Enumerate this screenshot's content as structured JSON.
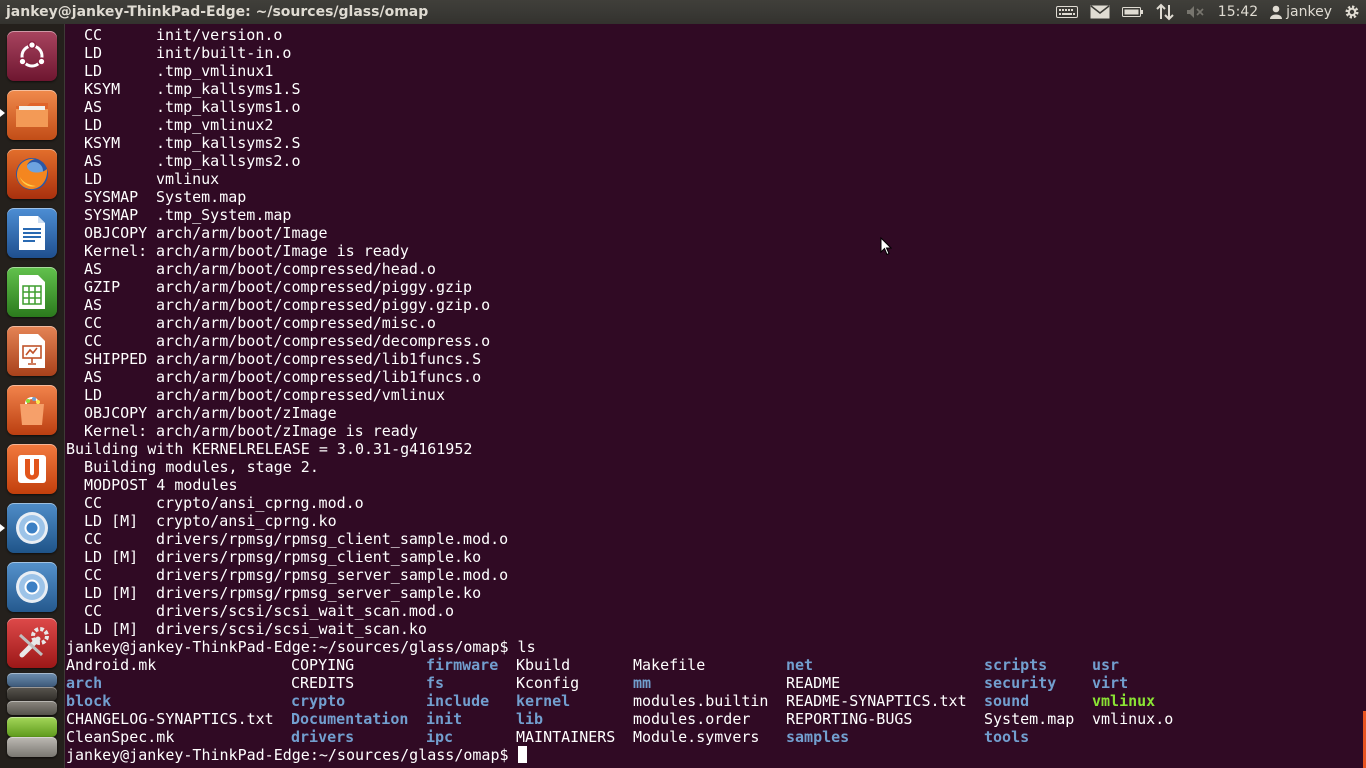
{
  "window": {
    "title": "jankey@jankey-ThinkPad-Edge: ~/sources/glass/omap"
  },
  "top_panel": {
    "indicators": [
      "keyboard-icon",
      "mail-icon",
      "battery-icon",
      "network-icon",
      "volume-muted-icon"
    ],
    "clock": "15:42",
    "user": "jankey"
  },
  "launcher": {
    "items": [
      {
        "name": "dash-home",
        "icon": "ubuntu-logo-icon",
        "color": "#8c2443"
      },
      {
        "name": "files",
        "icon": "folder-icon",
        "color": "#e26a2c"
      },
      {
        "name": "firefox",
        "icon": "firefox-icon",
        "color": "#c8491a"
      },
      {
        "name": "libreoffice-writer",
        "icon": "writer-icon",
        "color": "#2a6ab2"
      },
      {
        "name": "libreoffice-calc",
        "icon": "calc-icon",
        "color": "#3f9d2f"
      },
      {
        "name": "libreoffice-impress",
        "icon": "impress-icon",
        "color": "#c0532a"
      },
      {
        "name": "software-center",
        "icon": "shopping-bag-icon",
        "color": "#e0561e"
      },
      {
        "name": "ubuntu-one",
        "icon": "ubuntu-one-icon",
        "color": "#e2551b"
      },
      {
        "name": "chromium-1",
        "icon": "chromium-icon",
        "color": "#2f6fa9"
      },
      {
        "name": "chromium-2",
        "icon": "chromium-icon",
        "color": "#3572ae"
      },
      {
        "name": "system-settings",
        "icon": "settings-tools-icon",
        "color": "#c52c2c"
      }
    ],
    "stacked": [
      "system-monitor-icon",
      "terminal-icon",
      "workspaces-icon",
      "android-icon",
      "trash-icon"
    ]
  },
  "terminal": {
    "build_lines": [
      [
        "CC",
        "init/version.o"
      ],
      [
        "LD",
        "init/built-in.o"
      ],
      [
        "LD",
        ".tmp_vmlinux1"
      ],
      [
        "KSYM",
        ".tmp_kallsyms1.S"
      ],
      [
        "AS",
        ".tmp_kallsyms1.o"
      ],
      [
        "LD",
        ".tmp_vmlinux2"
      ],
      [
        "KSYM",
        ".tmp_kallsyms2.S"
      ],
      [
        "AS",
        ".tmp_kallsyms2.o"
      ],
      [
        "LD",
        "vmlinux"
      ],
      [
        "SYSMAP",
        "System.map"
      ],
      [
        "SYSMAP",
        ".tmp_System.map"
      ],
      [
        "OBJCOPY",
        "arch/arm/boot/Image"
      ],
      [
        "Kernel:",
        "arch/arm/boot/Image is ready"
      ],
      [
        "AS",
        "arch/arm/boot/compressed/head.o"
      ],
      [
        "GZIP",
        "arch/arm/boot/compressed/piggy.gzip"
      ],
      [
        "AS",
        "arch/arm/boot/compressed/piggy.gzip.o"
      ],
      [
        "CC",
        "arch/arm/boot/compressed/misc.o"
      ],
      [
        "CC",
        "arch/arm/boot/compressed/decompress.o"
      ],
      [
        "SHIPPED",
        "arch/arm/boot/compressed/lib1funcs.S"
      ],
      [
        "AS",
        "arch/arm/boot/compressed/lib1funcs.o"
      ],
      [
        "LD",
        "arch/arm/boot/compressed/vmlinux"
      ],
      [
        "OBJCOPY",
        "arch/arm/boot/zImage"
      ],
      [
        "Kernel:",
        "arch/arm/boot/zImage is ready"
      ]
    ],
    "kernelrelease_line": "Building with KERNELRELEASE = 3.0.31-g4161952",
    "modules_lines": [
      "  Building modules, stage 2.",
      "  MODPOST 4 modules"
    ],
    "module_lines": [
      [
        "CC",
        "crypto/ansi_cprng.mod.o"
      ],
      [
        "LD [M]",
        "crypto/ansi_cprng.ko"
      ],
      [
        "CC",
        "drivers/rpmsg/rpmsg_client_sample.mod.o"
      ],
      [
        "LD [M]",
        "drivers/rpmsg/rpmsg_client_sample.ko"
      ],
      [
        "CC",
        "drivers/rpmsg/rpmsg_server_sample.mod.o"
      ],
      [
        "LD [M]",
        "drivers/rpmsg/rpmsg_server_sample.ko"
      ],
      [
        "CC",
        "drivers/scsi/scsi_wait_scan.mod.o"
      ],
      [
        "LD [M]",
        "drivers/scsi/scsi_wait_scan.ko"
      ]
    ],
    "prompt": "jankey@jankey-ThinkPad-Edge:~/sources/glass/omap$",
    "command": " ls",
    "ls_columns": [
      [
        {
          "t": "Android.mk",
          "k": "file"
        },
        {
          "t": "arch",
          "k": "dir"
        },
        {
          "t": "block",
          "k": "dir"
        },
        {
          "t": "CHANGELOG-SYNAPTICS.txt",
          "k": "file"
        },
        {
          "t": "CleanSpec.mk",
          "k": "file"
        }
      ],
      [
        {
          "t": "COPYING",
          "k": "file"
        },
        {
          "t": "CREDITS",
          "k": "file"
        },
        {
          "t": "crypto",
          "k": "dir"
        },
        {
          "t": "Documentation",
          "k": "dir"
        },
        {
          "t": "drivers",
          "k": "dir"
        }
      ],
      [
        {
          "t": "firmware",
          "k": "dir"
        },
        {
          "t": "fs",
          "k": "dir"
        },
        {
          "t": "include",
          "k": "dir"
        },
        {
          "t": "init",
          "k": "dir"
        },
        {
          "t": "ipc",
          "k": "dir"
        }
      ],
      [
        {
          "t": "Kbuild",
          "k": "file"
        },
        {
          "t": "Kconfig",
          "k": "file"
        },
        {
          "t": "kernel",
          "k": "dir"
        },
        {
          "t": "lib",
          "k": "dir"
        },
        {
          "t": "MAINTAINERS",
          "k": "file"
        }
      ],
      [
        {
          "t": "Makefile",
          "k": "file"
        },
        {
          "t": "mm",
          "k": "dir"
        },
        {
          "t": "modules.builtin",
          "k": "file"
        },
        {
          "t": "modules.order",
          "k": "file"
        },
        {
          "t": "Module.symvers",
          "k": "file"
        }
      ],
      [
        {
          "t": "net",
          "k": "dir"
        },
        {
          "t": "README",
          "k": "file"
        },
        {
          "t": "README-SYNAPTICS.txt",
          "k": "file"
        },
        {
          "t": "REPORTING-BUGS",
          "k": "file"
        },
        {
          "t": "samples",
          "k": "dir"
        }
      ],
      [
        {
          "t": "scripts",
          "k": "dir"
        },
        {
          "t": "security",
          "k": "dir"
        },
        {
          "t": "sound",
          "k": "dir"
        },
        {
          "t": "System.map",
          "k": "file"
        },
        {
          "t": "tools",
          "k": "dir"
        }
      ],
      [
        {
          "t": "usr",
          "k": "dir"
        },
        {
          "t": "virt",
          "k": "dir"
        },
        {
          "t": "vmlinux",
          "k": "exe"
        },
        {
          "t": "vmlinux.o",
          "k": "file"
        }
      ]
    ]
  },
  "colors": {
    "terminal_bg": "#300a24",
    "terminal_fg": "#ffffff",
    "directory": "#729fcf",
    "executable": "#8ae234",
    "panel_bg": "#3c3b37",
    "launcher_bg": "#24201c"
  }
}
